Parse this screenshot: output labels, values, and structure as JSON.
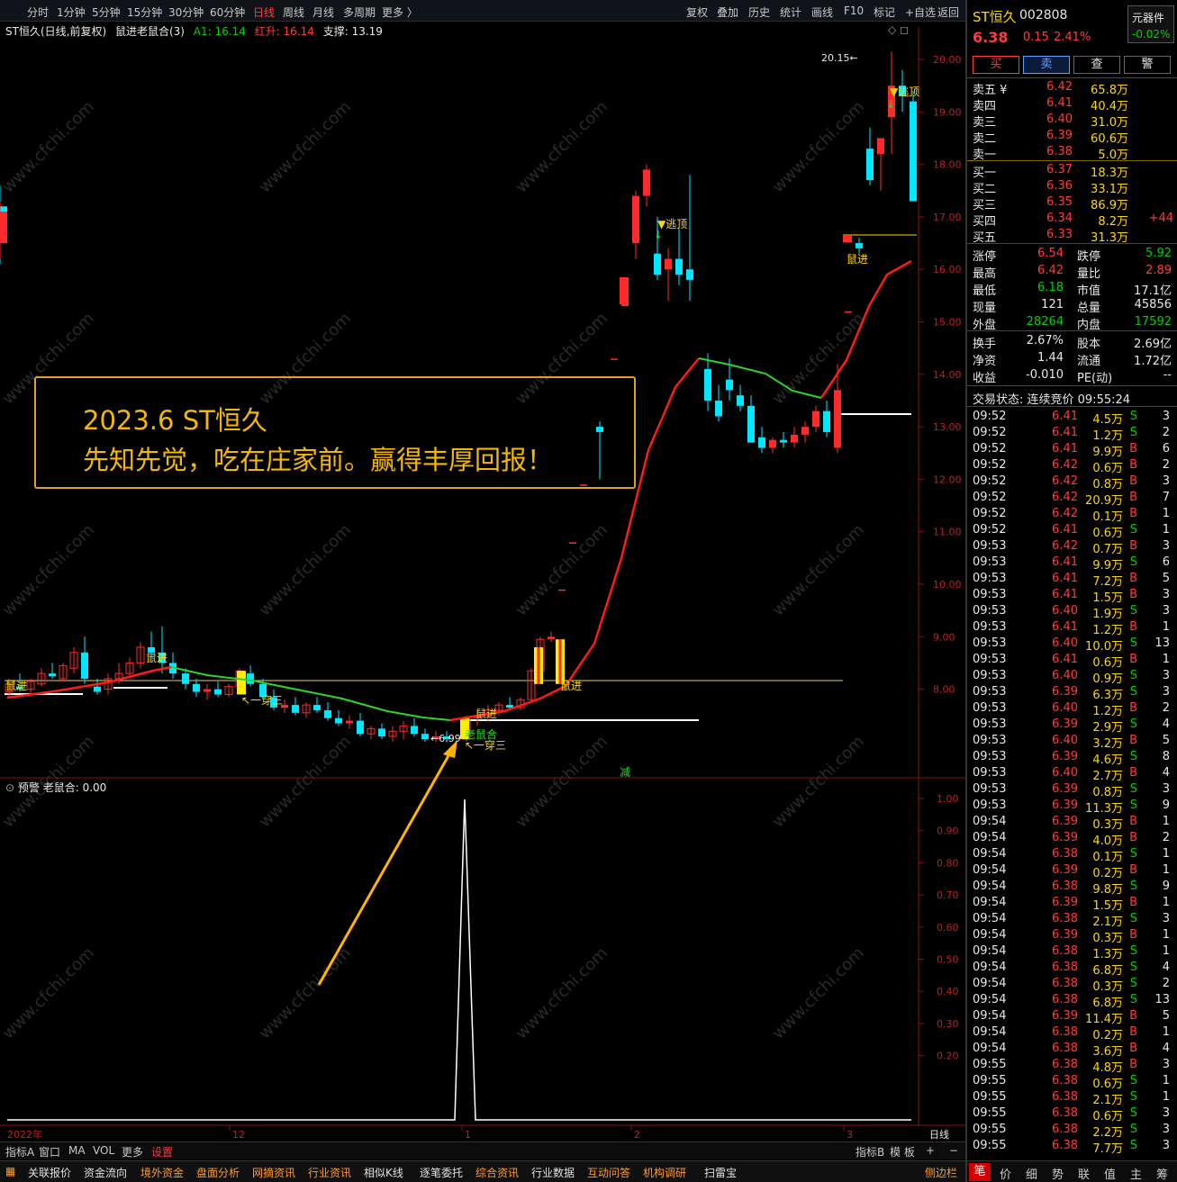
{
  "toolbar": {
    "periods": [
      "分时",
      "1分钟",
      "5分钟",
      "15分钟",
      "30分钟",
      "60分钟",
      "日线",
      "周线",
      "月线",
      "多周期",
      "更多 〉"
    ],
    "active_period": "日线",
    "tools": [
      "复权",
      "叠加",
      "历史",
      "统计",
      "画线",
      "F10",
      "标记",
      "+自选",
      "返回"
    ]
  },
  "chart_header": {
    "title": "ST恒久(日线,前复权)",
    "indicator": "鼠进老鼠合(3)",
    "a1_label": "A1: 16.14",
    "red_label": "红升: 16.14",
    "support_label": "支撑: 13.19"
  },
  "sub_header": "预警  老鼠合: 0.00",
  "annotation": {
    "line1": "2023.6 ST恒久",
    "line2": "先知先觉，吃在庄家前。赢得丰厚回报！"
  },
  "watermark": "www.cfchi.com",
  "chart_data": {
    "type": "candlestick",
    "main_y_ticks": [
      20,
      19,
      18,
      17,
      16,
      15,
      14,
      13,
      12,
      11,
      10,
      9,
      8
    ],
    "main_y_tick_labels": [
      "20.00",
      "19.00",
      "18.00",
      "17.00",
      "16.00",
      "15.00",
      "14.00",
      "13.00",
      "12.00",
      "11.00",
      "10.00",
      "9.00",
      "8.00"
    ],
    "sub_y_ticks": [
      1,
      0.9,
      0.8,
      0.7,
      0.6,
      0.5,
      0.4,
      0.3,
      0.2
    ],
    "sub_y_tick_labels": [
      "1.00",
      "0.90",
      "0.80",
      "0.70",
      "0.60",
      "0.50",
      "0.40",
      "0.30",
      "0.20"
    ],
    "x_labels": [
      "2022年",
      "12",
      "1",
      "2",
      "3",
      "日线"
    ],
    "high_marker": "20.15",
    "low_marker": "6.99",
    "labels_shubing": "鼠进",
    "labels_taoding": "逃顶",
    "labels_chuan": "一穿三",
    "labels_laoshu": "老鼠合",
    "label_jian": "减",
    "ylim_main": [
      6.8,
      20.3
    ],
    "ylim_sub": [
      0,
      1
    ]
  },
  "quote": {
    "name": "ST恒久",
    "code": "002808",
    "price": "6.38",
    "change": "0.15",
    "pct": "2.41%",
    "tool_label": "元器件",
    "tool_change": "-0.02%",
    "buttons": [
      "买",
      "卖",
      "查",
      "警"
    ]
  },
  "order_book": {
    "sell": [
      {
        "l": "卖五 ¥",
        "p": "6.42",
        "v": "65.8万"
      },
      {
        "l": "卖四",
        "p": "6.41",
        "v": "40.4万"
      },
      {
        "l": "卖三",
        "p": "6.40",
        "v": "31.0万"
      },
      {
        "l": "卖二",
        "p": "6.39",
        "v": "60.6万"
      },
      {
        "l": "卖一",
        "p": "6.38",
        "v": "5.0万"
      }
    ],
    "buy": [
      {
        "l": "买一",
        "p": "6.37",
        "v": "18.3万",
        "x": ""
      },
      {
        "l": "买二",
        "p": "6.36",
        "v": "33.1万",
        "x": ""
      },
      {
        "l": "买三",
        "p": "6.35",
        "v": "86.9万",
        "x": ""
      },
      {
        "l": "买四",
        "p": "6.34",
        "v": "8.2万",
        "x": "+44"
      },
      {
        "l": "买五",
        "p": "6.33",
        "v": "31.3万",
        "x": ""
      }
    ]
  },
  "stats": [
    [
      "涨停",
      "6.54",
      "跌停",
      "5.92"
    ],
    [
      "最高",
      "6.42",
      "量比",
      "2.89"
    ],
    [
      "最低",
      "6.18",
      "市值",
      "17.1亿"
    ],
    [
      "现量",
      "121",
      "总量",
      "45856"
    ],
    [
      "外盘",
      "28264",
      "内盘",
      "17592"
    ]
  ],
  "stats2": [
    [
      "换手",
      "2.67%",
      "股本",
      "2.69亿"
    ],
    [
      "净资",
      "1.44",
      "流通",
      "1.72亿"
    ],
    [
      "收益",
      "-0.010",
      "PE(动)",
      "--"
    ]
  ],
  "trade_status": "交易状态: 连续竞价 09:55:24",
  "ticks": [
    [
      "09:52",
      "6.41",
      "4.5万",
      "S",
      "3"
    ],
    [
      "09:52",
      "6.41",
      "1.2万",
      "S",
      "2"
    ],
    [
      "09:52",
      "6.41",
      "9.9万",
      "B",
      "6"
    ],
    [
      "09:52",
      "6.42",
      "0.6万",
      "B",
      "2"
    ],
    [
      "09:52",
      "6.42",
      "0.8万",
      "B",
      "3"
    ],
    [
      "09:52",
      "6.42",
      "20.9万",
      "B",
      "7"
    ],
    [
      "09:52",
      "6.42",
      "0.1万",
      "B",
      "1"
    ],
    [
      "09:52",
      "6.41",
      "0.6万",
      "S",
      "1"
    ],
    [
      "09:53",
      "6.42",
      "0.7万",
      "B",
      "3"
    ],
    [
      "09:53",
      "6.41",
      "9.9万",
      "S",
      "6"
    ],
    [
      "09:53",
      "6.41",
      "7.2万",
      "B",
      "5"
    ],
    [
      "09:53",
      "6.41",
      "1.5万",
      "B",
      "3"
    ],
    [
      "09:53",
      "6.40",
      "1.9万",
      "S",
      "3"
    ],
    [
      "09:53",
      "6.41",
      "1.2万",
      "B",
      "1"
    ],
    [
      "09:53",
      "6.40",
      "10.0万",
      "S",
      "13"
    ],
    [
      "09:53",
      "6.41",
      "0.6万",
      "B",
      "1"
    ],
    [
      "09:53",
      "6.40",
      "0.9万",
      "S",
      "3"
    ],
    [
      "09:53",
      "6.39",
      "6.3万",
      "S",
      "3"
    ],
    [
      "09:53",
      "6.40",
      "1.2万",
      "B",
      "2"
    ],
    [
      "09:53",
      "6.39",
      "2.9万",
      "S",
      "4"
    ],
    [
      "09:53",
      "6.40",
      "3.2万",
      "B",
      "5"
    ],
    [
      "09:53",
      "6.39",
      "4.6万",
      "S",
      "8"
    ],
    [
      "09:53",
      "6.40",
      "2.7万",
      "B",
      "4"
    ],
    [
      "09:53",
      "6.39",
      "0.8万",
      "S",
      "3"
    ],
    [
      "09:53",
      "6.39",
      "11.3万",
      "S",
      "9"
    ],
    [
      "09:54",
      "6.39",
      "0.3万",
      "B",
      "1"
    ],
    [
      "09:54",
      "6.39",
      "4.0万",
      "B",
      "2"
    ],
    [
      "09:54",
      "6.38",
      "0.1万",
      "S",
      "1"
    ],
    [
      "09:54",
      "6.39",
      "0.2万",
      "B",
      "1"
    ],
    [
      "09:54",
      "6.38",
      "9.8万",
      "S",
      "9"
    ],
    [
      "09:54",
      "6.39",
      "1.5万",
      "B",
      "1"
    ],
    [
      "09:54",
      "6.38",
      "2.1万",
      "S",
      "3"
    ],
    [
      "09:54",
      "6.39",
      "0.3万",
      "B",
      "1"
    ],
    [
      "09:54",
      "6.38",
      "1.3万",
      "S",
      "1"
    ],
    [
      "09:54",
      "6.38",
      "6.8万",
      "S",
      "4"
    ],
    [
      "09:54",
      "6.38",
      "0.3万",
      "S",
      "2"
    ],
    [
      "09:54",
      "6.38",
      "6.8万",
      "S",
      "13"
    ],
    [
      "09:54",
      "6.39",
      "11.4万",
      "B",
      "5"
    ],
    [
      "09:54",
      "6.38",
      "0.2万",
      "B",
      "1"
    ],
    [
      "09:54",
      "6.38",
      "3.6万",
      "B",
      "4"
    ],
    [
      "09:55",
      "6.38",
      "4.8万",
      "B",
      "3"
    ],
    [
      "09:55",
      "6.38",
      "0.6万",
      "S",
      "1"
    ],
    [
      "09:55",
      "6.38",
      "2.1万",
      "S",
      "1"
    ],
    [
      "09:55",
      "6.38",
      "0.6万",
      "S",
      "3"
    ],
    [
      "09:55",
      "6.38",
      "2.2万",
      "S",
      "3"
    ],
    [
      "09:55",
      "6.38",
      "7.7万",
      "S",
      "3"
    ]
  ],
  "bottom_tabs1": [
    "指标A",
    "窗口",
    "MA",
    "VOL",
    "更多",
    "设置"
  ],
  "bottom_tabs1_right": [
    "指标B",
    "模 板",
    "+",
    "−"
  ],
  "bottom_tabs2": [
    "关联报价",
    "资金流向",
    "境外资金",
    "盘面分析",
    "网摘资讯",
    "行业资讯",
    "相似K线",
    "逐笔委托",
    "综合资讯",
    "行业数据",
    "互动问答",
    "机构调研",
    "扫雷宝"
  ],
  "bottom_tabs2_right": "侧边栏",
  "right_bottom_tabs": [
    "笔",
    "价",
    "细",
    "势",
    "联",
    "值",
    "主",
    "筹"
  ]
}
